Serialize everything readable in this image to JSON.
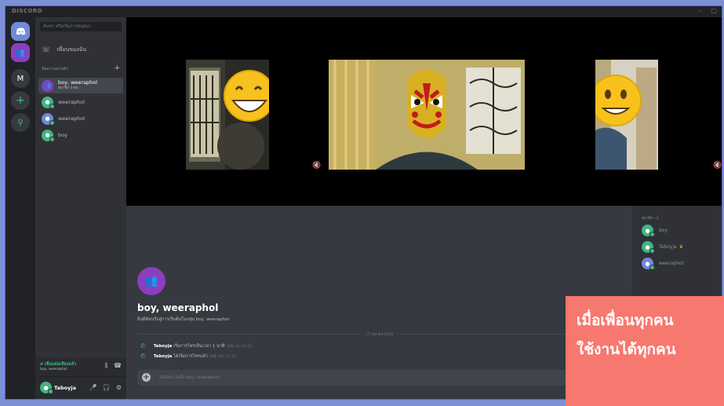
{
  "window": {
    "title": "DISCORD",
    "controls": [
      "–",
      "▢"
    ]
  },
  "guilds": [
    {
      "name": "home",
      "icon": "discord-logo-icon",
      "color": "#7289da"
    },
    {
      "name": "dm-group",
      "icon": "group-icon",
      "color": "#8b3fbf"
    },
    {
      "name": "server-m",
      "label": "M",
      "color": "#36393f"
    },
    {
      "name": "add-server",
      "icon": "plus-icon",
      "glyph": "+",
      "color": "#36393f"
    },
    {
      "name": "explore",
      "icon": "search-icon",
      "glyph": "⚲",
      "color": "#36393f"
    }
  ],
  "sidebar": {
    "search_placeholder": "ค้นหา หรือเริ่มการสนทนา",
    "friends_label": "เพื่อนของฉัน",
    "section_title": "ข้อความส่วนตัว",
    "dms": [
      {
        "name": "boy, weeraphol",
        "sub": "สมาชิก 3 คน",
        "color": "#8b3fbf",
        "active": true,
        "icon": "group-icon"
      },
      {
        "name": "weeraphol",
        "color": "#43b581",
        "icon": "discord-avatar-icon"
      },
      {
        "name": "weeraphol",
        "color": "#7289da",
        "icon": "discord-avatar-icon"
      },
      {
        "name": "boy",
        "color": "#43b581",
        "icon": "discord-avatar-icon"
      }
    ]
  },
  "voice": {
    "status": "เชื่อมต่อเสียงแล้ว",
    "channel": "boy, weeraphol"
  },
  "user": {
    "name": "Taboyja"
  },
  "members": {
    "header": "สมาชิก—3",
    "list": [
      {
        "name": "boy",
        "color": "#43b581"
      },
      {
        "name": "Taboyja",
        "owner": "♛",
        "color": "#43b581"
      },
      {
        "name": "weeraphol",
        "color": "#7289da"
      }
    ]
  },
  "chat": {
    "title": "boy, weeraphol",
    "description": "ยินดีต้อนรับสู่การเริ่มต้นในกลุ่ม boy, weeraphol",
    "date_divider": "27 เมษายน 2020",
    "messages": [
      {
        "author": "Taboyja",
        "text": "เริ่มการโทรเป็นเวลา 1 นาที",
        "time": "วันนี้ เวลา 11:11"
      },
      {
        "author": "Taboyja",
        "text": "ได้เริ่มการโทรแล้ว",
        "time": "วันนี้ เวลา 11:13"
      }
    ],
    "input_placeholder": "ส่งข้อความถึง boy, weeraphol"
  },
  "banner": {
    "line1": "เมื่อเพื่อนทุกคน",
    "line2": "ใช้งานได้ทุกคน",
    "color": "#f7786f"
  }
}
